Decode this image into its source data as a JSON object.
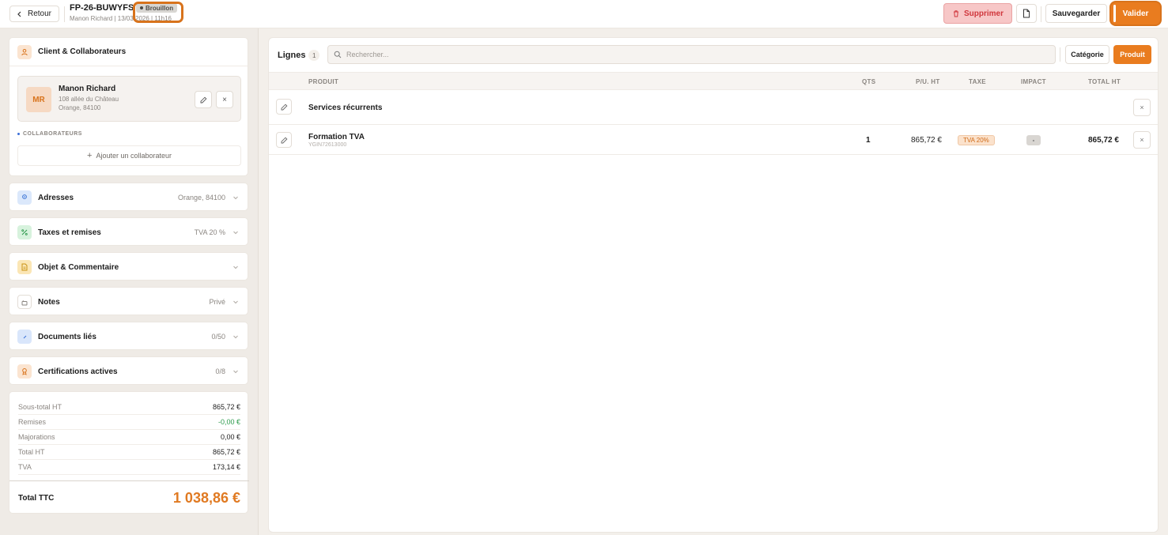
{
  "header": {
    "back_label": "Retour",
    "doc_number": "FP-26-BUWYFS",
    "status": "Brouillon",
    "subtitle": "Manon Richard | 13/03/2026 | 11h16",
    "delete_label": "Supprimer",
    "save_label": "Sauvegarder",
    "validate_label": "Valider"
  },
  "client_section": {
    "title": "Client & Collaborateurs",
    "client": {
      "initials": "MR",
      "name": "Manon Richard",
      "address_line1": "108 allée du Château",
      "address_line2": "Orange, 84100"
    },
    "collaborators_label": "COLLABORATEURS",
    "add_collaborator_label": "Ajouter un collaborateur"
  },
  "sections": [
    {
      "title": "Adresses",
      "meta": "Orange, 84100",
      "icon": "map-pin-icon",
      "icon_bg": "#dbe8fb",
      "icon_color": "#3b74d6"
    },
    {
      "title": "Taxes et remises",
      "meta": "TVA 20 %",
      "icon": "percent-icon",
      "icon_bg": "#d7f2dd",
      "icon_color": "#2f9a4e"
    },
    {
      "title": "Objet & Commentaire",
      "meta": "",
      "icon": "document-icon",
      "icon_bg": "#fbe6b5",
      "icon_color": "#c99213"
    },
    {
      "title": "Notes",
      "meta": "Privé",
      "icon": "lock-icon",
      "icon_bg": "#ffffff",
      "icon_color": "#8a8580"
    },
    {
      "title": "Documents liés",
      "meta": "0/50",
      "icon": "paperclip-icon",
      "icon_bg": "#d9e6fb",
      "icon_color": "#3b74d6"
    },
    {
      "title": "Certifications actives",
      "meta": "0/8",
      "icon": "award-icon",
      "icon_bg": "#fbe4d0",
      "icon_color": "#d8731c"
    }
  ],
  "totals": {
    "rows": [
      {
        "label": "Sous-total HT",
        "value": "865,72 €",
        "green": false
      },
      {
        "label": "Remises",
        "value": "-0,00 €",
        "green": true
      },
      {
        "label": "Majorations",
        "value": "0,00 €",
        "green": false
      },
      {
        "label": "Total HT",
        "value": "865,72 €",
        "green": false
      },
      {
        "label": "TVA",
        "value": "173,14 €",
        "green": false
      }
    ],
    "ttc_label": "Total TTC",
    "ttc_value": "1 038,86 €"
  },
  "lines": {
    "title": "Lignes",
    "count": "1",
    "search_placeholder": "Rechercher...",
    "category_button": "Catégorie",
    "product_button": "Produit",
    "columns": {
      "product": "PRODUIT",
      "qty": "QTS",
      "unit_price": "P/U. HT",
      "tax": "TAXE",
      "impact": "IMPACT",
      "total": "TOTAL HT"
    },
    "category_row": {
      "name": "Services récurrents"
    },
    "product_row": {
      "name": "Formation TVA",
      "ref": "YGIN72613000",
      "qty": "1",
      "unit_price": "865,72 €",
      "tax": "TVA 20%",
      "impact": "-",
      "total": "865,72 €"
    }
  },
  "colors": {
    "accent": "#e97c1f",
    "danger_bg": "#f7c7c7",
    "danger_text": "#d0363c"
  }
}
